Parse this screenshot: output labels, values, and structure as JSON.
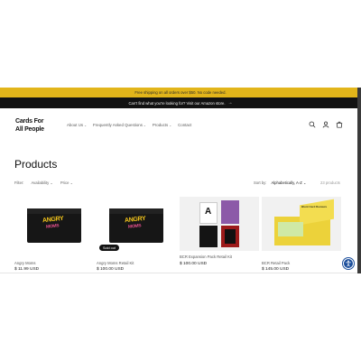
{
  "announcements": {
    "top": "Free shipping on all orders over $50. No code needed.",
    "second": "Can't find what you're looking for? Visit our Amazon store.",
    "second_arrow": "→"
  },
  "logo": {
    "line1": "Cards For",
    "line2": "All People"
  },
  "nav": [
    {
      "label": "About Us",
      "dropdown": true
    },
    {
      "label": "Frequently Asked Questions",
      "dropdown": true
    },
    {
      "label": "Products",
      "dropdown": true
    },
    {
      "label": "Contact",
      "dropdown": false
    }
  ],
  "header_icons": [
    "search-icon",
    "account-icon",
    "cart-icon"
  ],
  "page_title": "Products",
  "filters": {
    "label": "Filter:",
    "availability": "Availability",
    "price": "Price"
  },
  "sort": {
    "label": "Sort by:",
    "value": "Alphabetically, A-Z",
    "count": "23 products"
  },
  "products": [
    {
      "name": "Angry Moms",
      "price": "$ 11.99 USD",
      "sold_out": ""
    },
    {
      "name": "Angry Moms Retail Kit",
      "price": "$ 100.00 USD",
      "sold_out": "Sold out"
    },
    {
      "name": "BCR Expansion Pack Retail Kit",
      "price": "$ 100.00 USD",
      "sold_out": ""
    },
    {
      "name": "BCR Retail Pack",
      "price": "$ 145.00 USD",
      "sold_out": ""
    }
  ],
  "box_art": {
    "title": "ANGRY",
    "subtitle": "MOMS"
  },
  "expansion_art": {
    "letter": "A"
  },
  "retail_art": {
    "label": "Blunt Card Reviews"
  },
  "colors": {
    "accent": "#e2b51a",
    "dark": "#121212",
    "a11y": "#1c4f9c"
  }
}
